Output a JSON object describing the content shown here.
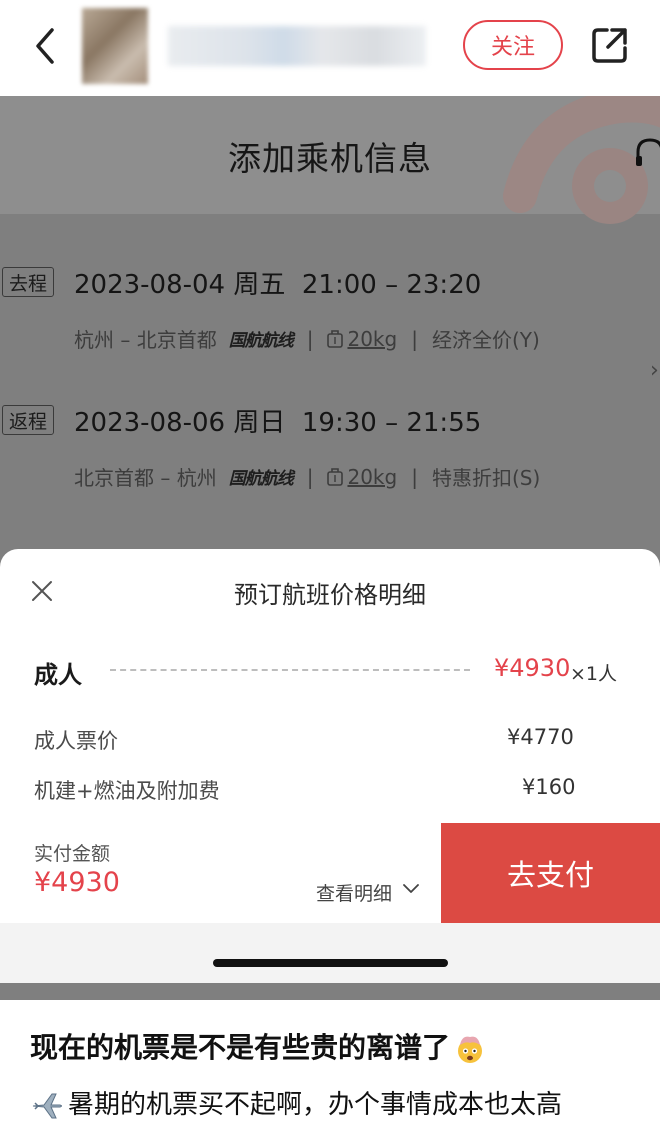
{
  "topbar": {
    "follow_label": "关注"
  },
  "booking": {
    "title": "添加乘机信息",
    "outbound": {
      "tag": "去程",
      "datetime": "2023-08-04 周五  21:00 – 23:20",
      "route": "杭州 – 北京首都",
      "airline": "国航航线",
      "baggage": "20kg",
      "cabin": "经济全价(Y)"
    },
    "return": {
      "tag": "返程",
      "datetime": "2023-08-06 周日  19:30 – 21:55",
      "route": "北京首都 – 杭州",
      "airline": "国航航线",
      "baggage": "20kg",
      "cabin": "特惠折扣(S)"
    }
  },
  "price_sheet": {
    "title": "预订航班价格明细",
    "adult_label": "成人",
    "adult_price": "¥4930",
    "adult_multiplier": "×1人",
    "lines": [
      {
        "label": "成人票价",
        "value": "¥4770"
      },
      {
        "label": "机建+燃油及附加费",
        "value": "¥160"
      }
    ],
    "paid_label": "实付金额",
    "paid_amount": "¥4930",
    "detail_link": "查看明细",
    "pay_button": "去支付"
  },
  "post": {
    "title": "现在的机票是不是有些贵的离谱了",
    "body": "暑期的机票买不起啊，办个事情成本也太高"
  },
  "colors": {
    "accent": "#e4434b",
    "pay_button": "#dc4a43"
  }
}
